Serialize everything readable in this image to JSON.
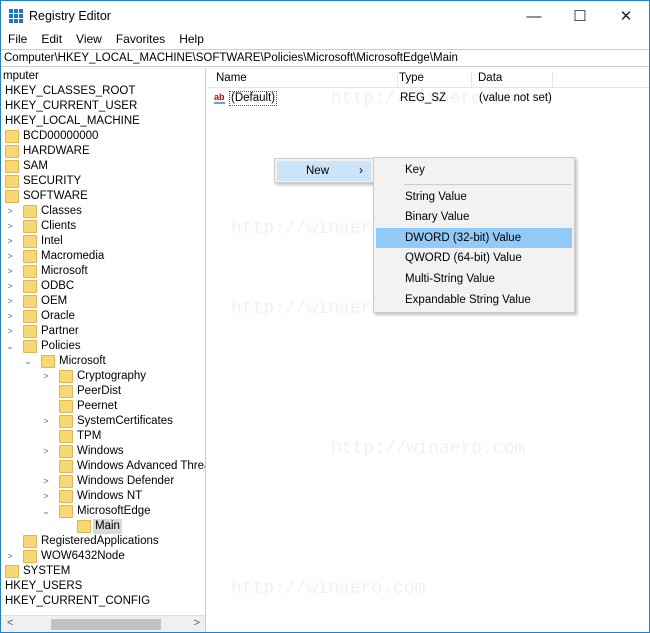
{
  "window": {
    "title": "Registry Editor",
    "minimize": "—",
    "maximize": "☐",
    "close": "✕"
  },
  "menu": [
    "File",
    "Edit",
    "View",
    "Favorites",
    "Help"
  ],
  "address": "Computer\\HKEY_LOCAL_MACHINE\\SOFTWARE\\Policies\\Microsoft\\MicrosoftEdge\\Main",
  "tree": [
    {
      "label": "mputer",
      "level": 0,
      "exp": "none",
      "folder": false
    },
    {
      "label": "HKEY_CLASSES_ROOT",
      "level": 1,
      "exp": "none",
      "folder": false
    },
    {
      "label": "HKEY_CURRENT_USER",
      "level": 1,
      "exp": "none",
      "folder": false
    },
    {
      "label": "HKEY_LOCAL_MACHINE",
      "level": 1,
      "exp": "none",
      "folder": false
    },
    {
      "label": "BCD00000000",
      "level": 2,
      "exp": "none",
      "folder": true
    },
    {
      "label": "HARDWARE",
      "level": 2,
      "exp": "none",
      "folder": true
    },
    {
      "label": "SAM",
      "level": 2,
      "exp": "none",
      "folder": true
    },
    {
      "label": "SECURITY",
      "level": 2,
      "exp": "none",
      "folder": true
    },
    {
      "label": "SOFTWARE",
      "level": 2,
      "exp": "none",
      "folder": true
    },
    {
      "label": "Classes",
      "level": 3,
      "exp": "closed",
      "folder": true
    },
    {
      "label": "Clients",
      "level": 3,
      "exp": "closed",
      "folder": true
    },
    {
      "label": "Intel",
      "level": 3,
      "exp": "closed",
      "folder": true
    },
    {
      "label": "Macromedia",
      "level": 3,
      "exp": "closed",
      "folder": true
    },
    {
      "label": "Microsoft",
      "level": 3,
      "exp": "closed",
      "folder": true
    },
    {
      "label": "ODBC",
      "level": 3,
      "exp": "closed",
      "folder": true
    },
    {
      "label": "OEM",
      "level": 3,
      "exp": "closed",
      "folder": true
    },
    {
      "label": "Oracle",
      "level": 3,
      "exp": "closed",
      "folder": true
    },
    {
      "label": "Partner",
      "level": 3,
      "exp": "closed",
      "folder": true
    },
    {
      "label": "Policies",
      "level": 3,
      "exp": "open",
      "folder": true
    },
    {
      "label": "Microsoft",
      "level": 4,
      "exp": "open",
      "folder": true
    },
    {
      "label": "Cryptography",
      "level": 5,
      "exp": "closed",
      "folder": true
    },
    {
      "label": "PeerDist",
      "level": 5,
      "exp": "none",
      "folder": true
    },
    {
      "label": "Peernet",
      "level": 5,
      "exp": "none",
      "folder": true
    },
    {
      "label": "SystemCertificates",
      "level": 5,
      "exp": "closed",
      "folder": true
    },
    {
      "label": "TPM",
      "level": 5,
      "exp": "none",
      "folder": true
    },
    {
      "label": "Windows",
      "level": 5,
      "exp": "closed",
      "folder": true
    },
    {
      "label": "Windows Advanced Threat",
      "level": 5,
      "exp": "none",
      "folder": true
    },
    {
      "label": "Windows Defender",
      "level": 5,
      "exp": "closed",
      "folder": true
    },
    {
      "label": "Windows NT",
      "level": 5,
      "exp": "closed",
      "folder": true
    },
    {
      "label": "MicrosoftEdge",
      "level": 5,
      "exp": "open",
      "folder": true
    },
    {
      "label": "Main",
      "level": 6,
      "exp": "none",
      "folder": true,
      "selected": true
    },
    {
      "label": "RegisteredApplications",
      "level": 3,
      "exp": "none",
      "folder": true
    },
    {
      "label": "WOW6432Node",
      "level": 3,
      "exp": "closed",
      "folder": true
    },
    {
      "label": "SYSTEM",
      "level": 2,
      "exp": "none",
      "folder": true
    },
    {
      "label": "HKEY_USERS",
      "level": 1,
      "exp": "none",
      "folder": false
    },
    {
      "label": "HKEY_CURRENT_CONFIG",
      "level": 1,
      "exp": "none",
      "folder": false
    }
  ],
  "columns": {
    "name": "Name",
    "type": "Type",
    "data": "Data"
  },
  "values": [
    {
      "name": "(Default)",
      "type": "REG_SZ",
      "data": "(value not set)"
    }
  ],
  "context_menu": {
    "new": "New",
    "arrow": "›"
  },
  "submenu": [
    "Key",
    "String Value",
    "Binary Value",
    "DWORD (32-bit) Value",
    "QWORD (64-bit) Value",
    "Multi-String Value",
    "Expandable String Value"
  ],
  "highlighted_submenu_index": 3,
  "watermark": "http://winaero.com"
}
